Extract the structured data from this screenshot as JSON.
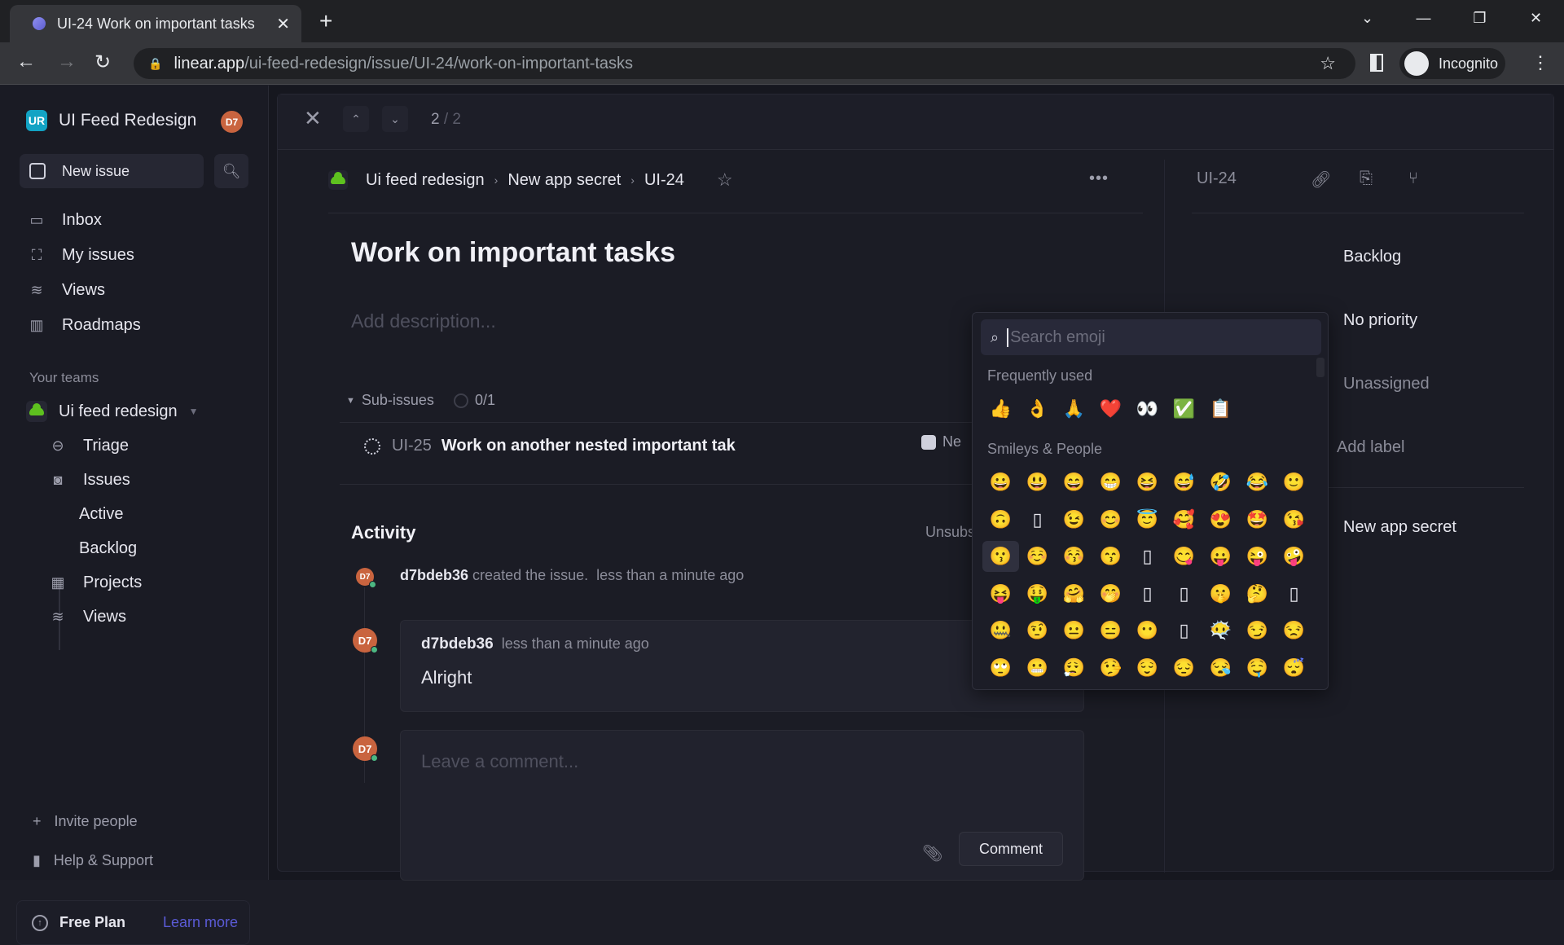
{
  "browser": {
    "tab_title": "UI-24 Work on important tasks",
    "url_host": "linear.app",
    "url_path": "/ui-feed-redesign/issue/UI-24/work-on-important-tasks",
    "profile_label": "Incognito"
  },
  "sidebar": {
    "workspace_logo": "UR",
    "workspace_name": "UI Feed Redesign",
    "user_initials": "D7",
    "new_issue_label": "New issue",
    "nav": [
      {
        "label": "Inbox",
        "icon": "inbox-icon"
      },
      {
        "label": "My issues",
        "icon": "target-icon"
      },
      {
        "label": "Views",
        "icon": "layers-icon"
      },
      {
        "label": "Roadmaps",
        "icon": "map-icon"
      }
    ],
    "teams_label": "Your teams",
    "team_name": "Ui feed redesign",
    "team_items": [
      {
        "label": "Triage"
      },
      {
        "label": "Issues"
      },
      {
        "label": "Active"
      },
      {
        "label": "Backlog"
      },
      {
        "label": "Projects"
      },
      {
        "label": "Views"
      }
    ],
    "invite_label": "Invite people",
    "help_label": "Help & Support",
    "plan_label": "Free Plan",
    "plan_link": "Learn more"
  },
  "issue": {
    "counter_current": "2",
    "counter_total": "/ 2",
    "breadcrumb": [
      "Ui feed redesign",
      "New app secret",
      "UI-24"
    ],
    "title": "Work on important tasks",
    "description_placeholder": "Add description...",
    "subissues_label": "Sub-issues",
    "subissues_progress": "0/1",
    "subissue": {
      "id": "UI-25",
      "title": "Work on another nested important tak",
      "project": "Ne"
    },
    "activity_label": "Activity",
    "unsubscribe_label": "Unsubs",
    "created_event": {
      "user": "d7bdeb36",
      "text": "created the issue.",
      "time": "less than a minute ago",
      "initials": "D7"
    },
    "comment": {
      "user": "d7bdeb36",
      "time": "less than a minute ago",
      "body": "Alright",
      "initials": "D7"
    },
    "compose_placeholder": "Leave a comment...",
    "compose_button": "Comment",
    "compose_initials": "D7"
  },
  "panel": {
    "id": "UI-24",
    "status": "Backlog",
    "priority": "No priority",
    "assignee": "Unassigned",
    "label": "Add label",
    "project": "New app secret"
  },
  "emoji_picker": {
    "search_placeholder": "Search emoji",
    "frequent_label": "Frequently used",
    "frequent": [
      "👍",
      "👌",
      "🙏",
      "❤️",
      "👀",
      "✅",
      "📋"
    ],
    "smileys_label": "Smileys & People",
    "smileys": [
      [
        "😀",
        "😃",
        "😄",
        "😁",
        "😆",
        "😅",
        "🤣",
        "😂",
        "🙂"
      ],
      [
        "🙃",
        "▯",
        "😉",
        "😊",
        "😇",
        "🥰",
        "😍",
        "🤩",
        "😘"
      ],
      [
        "😗",
        "☺️",
        "😚",
        "😙",
        "▯",
        "😋",
        "😛",
        "😜",
        "🤪"
      ],
      [
        "😝",
        "🤑",
        "🤗",
        "🤭",
        "▯",
        "▯",
        "🤫",
        "🤔",
        "▯"
      ],
      [
        "🤐",
        "🤨",
        "😐",
        "😑",
        "😶",
        "▯",
        "😶‍🌫️",
        "😏",
        "😒"
      ],
      [
        "🙄",
        "😬",
        "😮‍💨",
        "🤥",
        "😌",
        "😔",
        "😪",
        "🤤",
        "😴"
      ]
    ],
    "hovered": "😗"
  }
}
